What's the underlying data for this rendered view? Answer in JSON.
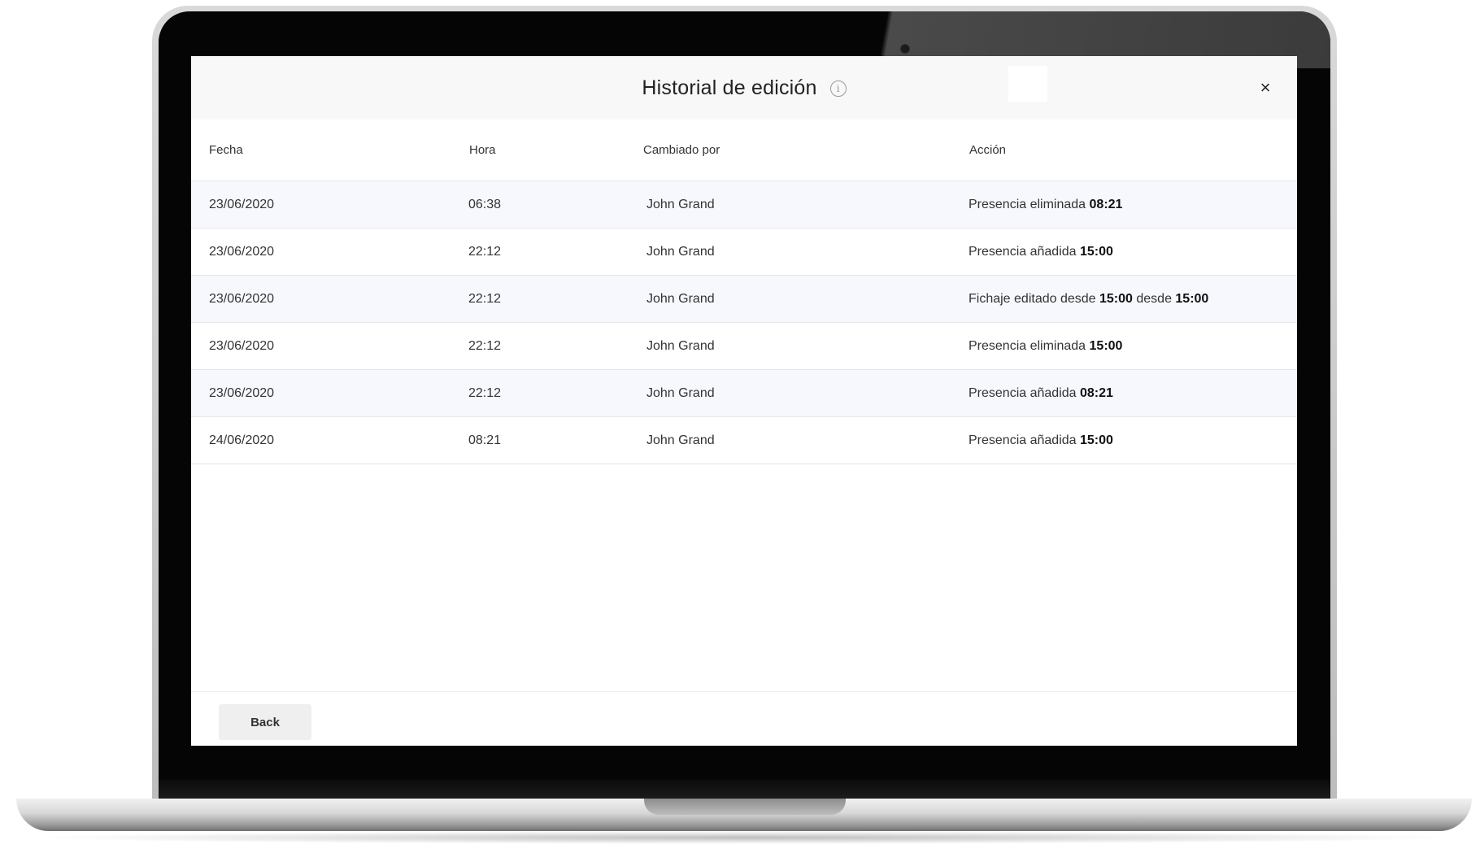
{
  "modal": {
    "title": "Historial de edición",
    "info_icon": "info-icon",
    "close_label": "×"
  },
  "table": {
    "columns": [
      "Fecha",
      "Hora",
      "Cambiado por",
      "Acción"
    ],
    "rows": [
      {
        "fecha": "23/06/2020",
        "hora": "06:38",
        "cambiado_por": "John Grand",
        "accion_prefix": "Presencia eliminada ",
        "accion_time1": "08:21",
        "accion_mid": "",
        "accion_time2": ""
      },
      {
        "fecha": "23/06/2020",
        "hora": "22:12",
        "cambiado_por": "John Grand",
        "accion_prefix": "Presencia añadida ",
        "accion_time1": "15:00",
        "accion_mid": "",
        "accion_time2": ""
      },
      {
        "fecha": "23/06/2020",
        "hora": "22:12",
        "cambiado_por": "John Grand",
        "accion_prefix": "Fichaje editado desde ",
        "accion_time1": "15:00",
        "accion_mid": " desde ",
        "accion_time2": "15:00"
      },
      {
        "fecha": "23/06/2020",
        "hora": "22:12",
        "cambiado_por": "John Grand",
        "accion_prefix": "Presencia eliminada ",
        "accion_time1": "15:00",
        "accion_mid": "",
        "accion_time2": ""
      },
      {
        "fecha": "23/06/2020",
        "hora": "22:12",
        "cambiado_por": "John Grand",
        "accion_prefix": "Presencia añadida ",
        "accion_time1": "08:21",
        "accion_mid": "",
        "accion_time2": ""
      },
      {
        "fecha": "24/06/2020",
        "hora": "08:21",
        "cambiado_por": "John Grand",
        "accion_prefix": "Presencia añadida ",
        "accion_time1": "15:00",
        "accion_mid": "",
        "accion_time2": ""
      }
    ]
  },
  "footer": {
    "back_label": "Back"
  }
}
